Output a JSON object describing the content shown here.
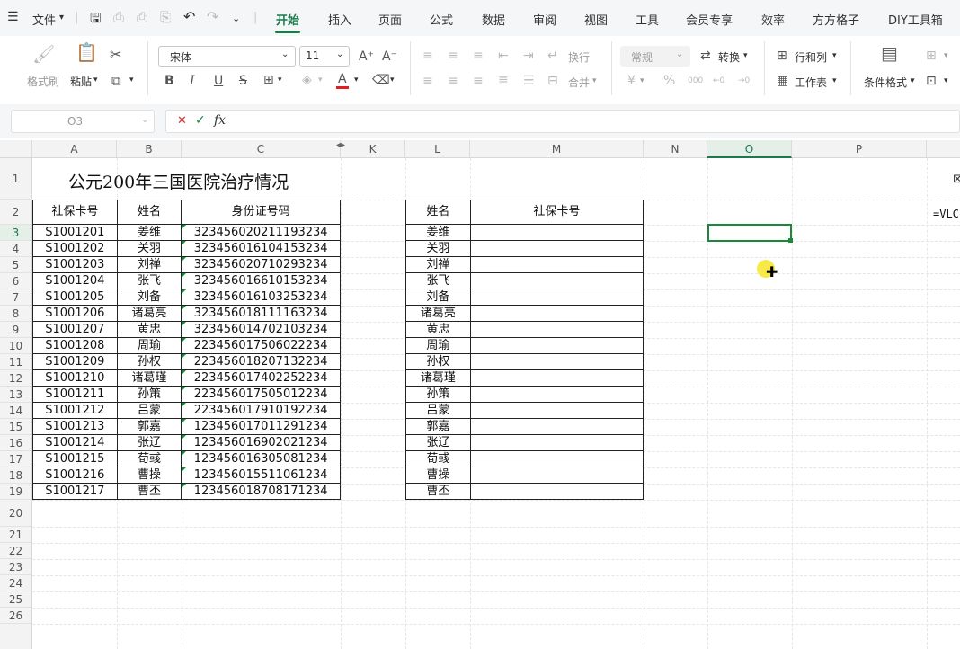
{
  "menu": {
    "file": "文件",
    "tabs": [
      "开始",
      "插入",
      "页面",
      "公式",
      "数据",
      "审阅",
      "视图",
      "工具",
      "会员专享",
      "效率",
      "方方格子",
      "DIY工具箱"
    ],
    "active_tab": "开始"
  },
  "ribbon": {
    "format_painter": "格式刷",
    "paste": "粘贴",
    "font_name": "宋体",
    "font_size": "11",
    "wrap": "换行",
    "merge": "合并",
    "number_format": "常规",
    "convert": "转换",
    "rows_cols": "行和列",
    "worksheet": "工作表",
    "cond_format": "条件格式",
    "bold": "B",
    "italic": "I",
    "underline": "U",
    "strike": "S",
    "font_color_letter": "A",
    "percent": "%",
    "yen": "¥",
    "grow_font": "A⁺",
    "shrink_font": "A⁻"
  },
  "formula_bar": {
    "cell_ref": "O3",
    "fx": "fx",
    "cancel": "✕",
    "confirm": "✓",
    "content": ""
  },
  "columns": [
    "A",
    "B",
    "C",
    "K",
    "L",
    "M",
    "N",
    "O",
    "P"
  ],
  "selected_column": "O",
  "rows": [
    "1",
    "2",
    "3",
    "4",
    "5",
    "6",
    "7",
    "8",
    "9",
    "10",
    "11",
    "12",
    "13",
    "14",
    "15",
    "16",
    "17",
    "18",
    "19",
    "20",
    "21",
    "22",
    "23",
    "24",
    "25",
    "26"
  ],
  "selected_row": "3",
  "sheet": {
    "title": "公元200年三国医院治疗情况",
    "left_table": {
      "headers": [
        "社保卡号",
        "姓名",
        "身份证号码"
      ],
      "rows": [
        [
          "S1001201",
          "姜维",
          "323456020211193234"
        ],
        [
          "S1001202",
          "关羽",
          "323456016104153234"
        ],
        [
          "S1001203",
          "刘禅",
          "323456020710293234"
        ],
        [
          "S1001204",
          "张飞",
          "323456016610153234"
        ],
        [
          "S1001205",
          "刘备",
          "323456016103253234"
        ],
        [
          "S1001206",
          "诸葛亮",
          "323456018111163234"
        ],
        [
          "S1001207",
          "黄忠",
          "323456014702103234"
        ],
        [
          "S1001208",
          "周瑜",
          "223456017506022234"
        ],
        [
          "S1001209",
          "孙权",
          "223456018207132234"
        ],
        [
          "S1001210",
          "诸葛瑾",
          "223456017402252234"
        ],
        [
          "S1001211",
          "孙策",
          "223456017505012234"
        ],
        [
          "S1001212",
          "吕蒙",
          "223456017910192234"
        ],
        [
          "S1001213",
          "郭嘉",
          "123456017011291234"
        ],
        [
          "S1001214",
          "张辽",
          "123456016902021234"
        ],
        [
          "S1001215",
          "荀彧",
          "123456016305081234"
        ],
        [
          "S1001216",
          "曹操",
          "123456015511061234"
        ],
        [
          "S1001217",
          "曹丕",
          "123456018708171234"
        ]
      ]
    },
    "right_table": {
      "headers": [
        "姓名",
        "社保卡号"
      ],
      "names": [
        "姜维",
        "关羽",
        "刘禅",
        "张飞",
        "刘备",
        "诸葛亮",
        "黄忠",
        "周瑜",
        "孙权",
        "诸葛瑾",
        "孙策",
        "吕蒙",
        "郭嘉",
        "张辽",
        "荀彧",
        "曹操",
        "曹丕"
      ]
    },
    "right_edge_formula": "=VLC",
    "right_edge_icon": "⊠"
  }
}
